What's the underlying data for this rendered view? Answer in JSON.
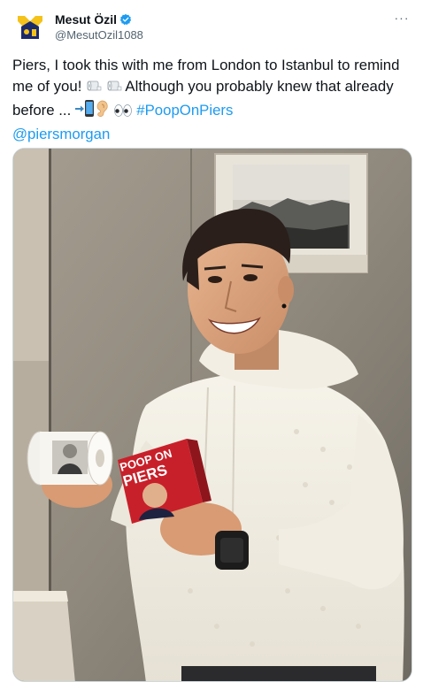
{
  "author": {
    "display_name": "Mesut Özil",
    "handle": "@MesutOzil1088",
    "verified": true,
    "avatar_icon": "mo-logo-avatar-icon"
  },
  "menu": {
    "more_icon": "more-options-icon",
    "more_label": "···"
  },
  "tweet": {
    "text_part1": "Piers, I took this with me from London to Istanbul to remind me of you! ",
    "text_part2": " Although you probably knew that already before ... ",
    "hashtag": "#PoopOnPiers",
    "mention": "@piersmorgan",
    "emojis": [
      "toilet-paper",
      "toilet-paper",
      "arrow-right-phone",
      "ear",
      "eyes"
    ]
  },
  "media": {
    "type": "photo",
    "toilet_roll_label_line1": "POOP ON",
    "toilet_roll_label_line2": "PIERS"
  },
  "colors": {
    "link": "#1d9bf0",
    "verified": "#1d9bf0",
    "text": "#0f1419",
    "secondary": "#536471"
  }
}
